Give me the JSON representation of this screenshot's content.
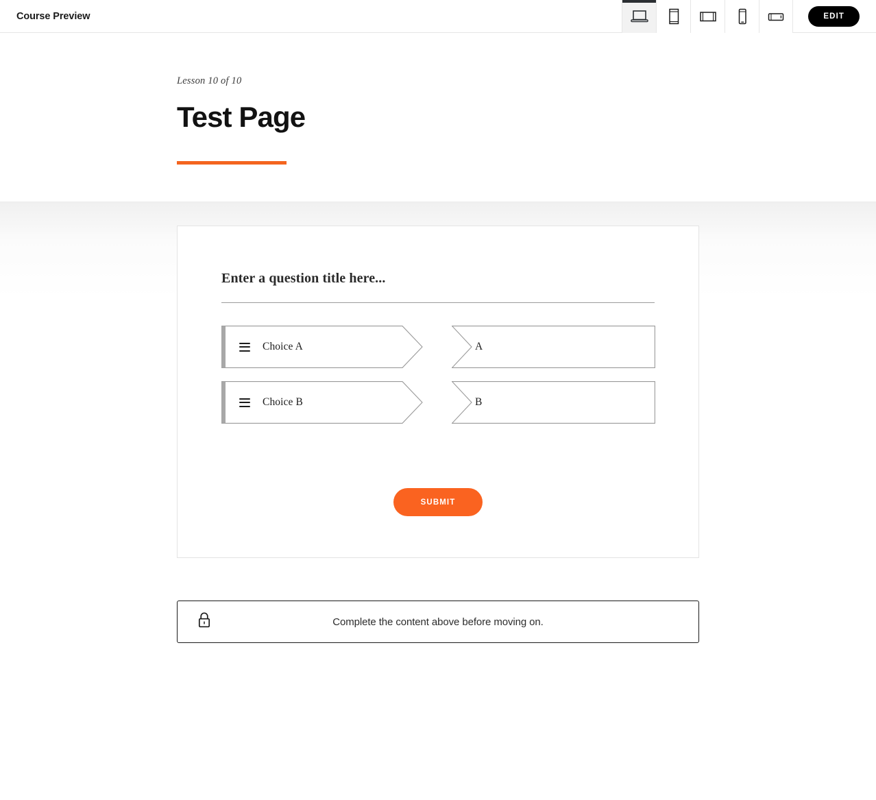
{
  "topbar": {
    "brand": "Course Preview",
    "edit_label": "EDIT",
    "devices": [
      {
        "name": "desktop",
        "label": "Desktop",
        "active": true
      },
      {
        "name": "tablet-portrait",
        "label": "Tablet Portrait",
        "active": false
      },
      {
        "name": "tablet-landscape",
        "label": "Tablet Landscape",
        "active": false
      },
      {
        "name": "mobile-portrait",
        "label": "Mobile Portrait",
        "active": false
      },
      {
        "name": "mobile-landscape",
        "label": "Mobile Landscape",
        "active": false
      }
    ]
  },
  "lesson": {
    "eyebrow": "Lesson 10 of 10",
    "title": "Test Page"
  },
  "question": {
    "title": "Enter a question title here...",
    "rows": [
      {
        "choice": "Choice A",
        "target": "A"
      },
      {
        "choice": "Choice B",
        "target": "B"
      }
    ],
    "submit_label": "SUBMIT"
  },
  "locked": {
    "message": "Complete the content above before moving on.",
    "icon": "lock-icon"
  },
  "colors": {
    "accent_orange": "#f4651f",
    "submit_orange": "#fa6320",
    "dark": "#000000",
    "choice_bar_gray": "#a8a8a8",
    "shape_border": "#9a9a9a"
  }
}
